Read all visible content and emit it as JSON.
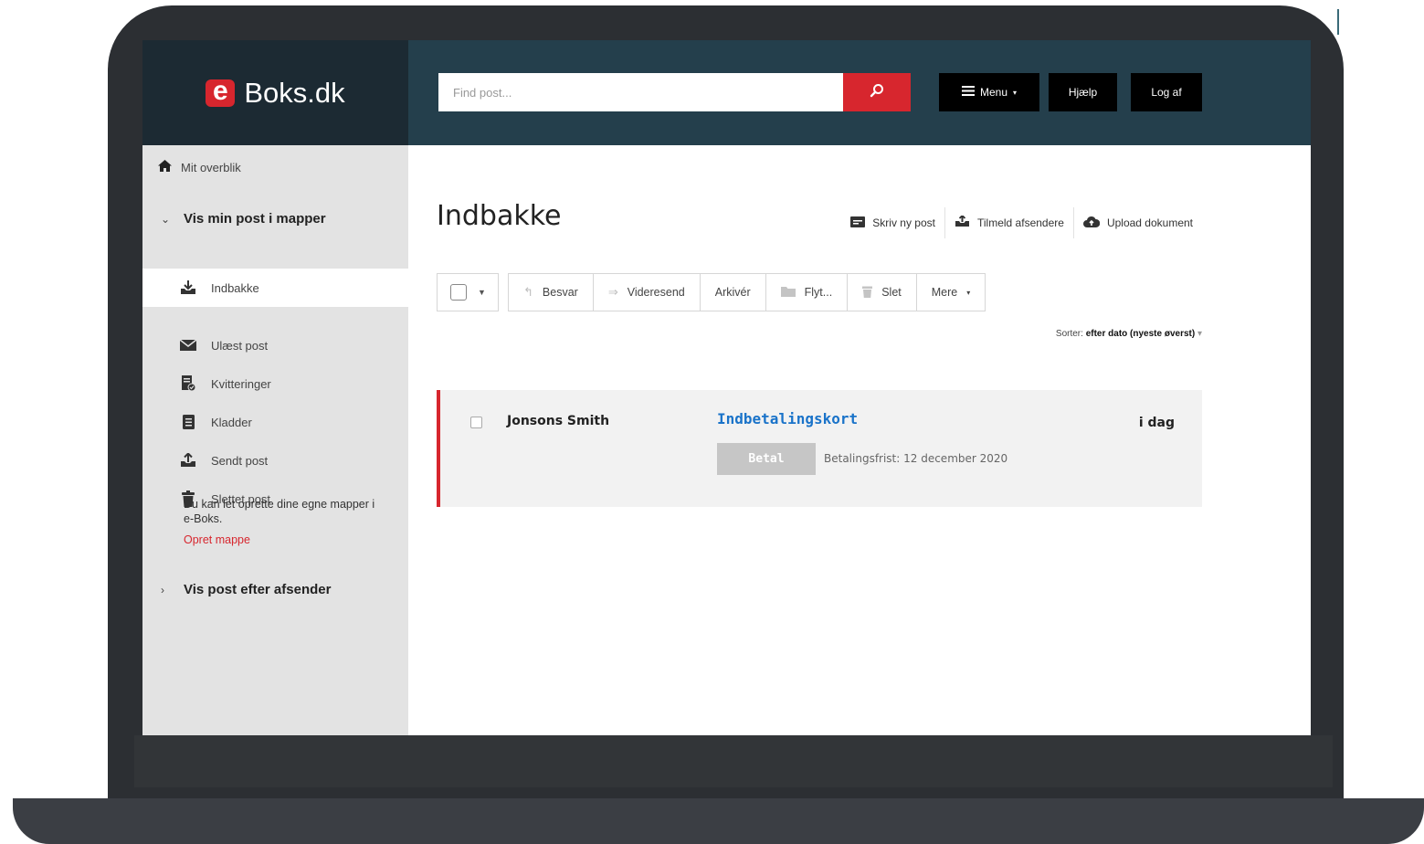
{
  "brand": {
    "logo_letter": "e",
    "logo_text": "Boks.dk"
  },
  "header": {
    "search_placeholder": "Find post...",
    "menu_label": "Menu",
    "help_label": "Hjælp",
    "logout_label": "Log af"
  },
  "sidebar": {
    "overview_label": "Mit overblik",
    "folders_section": "Vis min post i mapper",
    "items": [
      {
        "label": "Indbakke",
        "icon": "inbox-download-icon",
        "active": true
      },
      {
        "label": "Ulæst post",
        "icon": "envelope-icon",
        "active": false
      },
      {
        "label": "Kvitteringer",
        "icon": "receipt-icon",
        "active": false
      },
      {
        "label": "Kladder",
        "icon": "draft-document-icon",
        "active": false
      },
      {
        "label": "Sendt post",
        "icon": "upload-tray-icon",
        "active": false
      },
      {
        "label": "Slettet post",
        "icon": "trash-icon",
        "active": false
      }
    ],
    "note": "Du kan let oprette dine egne mapper i e-Boks.",
    "create_folder_link": "Opret mappe",
    "sender_section": "Vis post efter afsender"
  },
  "main": {
    "title": "Indbakke",
    "actions": [
      {
        "label": "Skriv ny post",
        "icon": "compose-icon"
      },
      {
        "label": "Tilmeld afsendere",
        "icon": "subscribe-icon"
      },
      {
        "label": "Upload dokument",
        "icon": "cloud-upload-icon"
      }
    ],
    "toolbar": {
      "reply": "Besvar",
      "forward": "Videresend",
      "archive": "Arkivér",
      "move": "Flyt...",
      "delete": "Slet",
      "more": "Mere"
    },
    "sort_prefix": "Sorter:",
    "sort_value": "efter dato (nyeste øverst)",
    "messages": [
      {
        "sender": "Jonsons Smith",
        "subject": "Indbetalingskort",
        "date": "i dag",
        "pay_button": "Betal",
        "due": "Betalingsfrist: 12 december 2020",
        "unread": true
      }
    ]
  },
  "colors": {
    "accent_red": "#d7262e",
    "header_bg": "#243f4c",
    "logo_bg": "#1c2a33",
    "link_blue": "#1a73c9"
  }
}
